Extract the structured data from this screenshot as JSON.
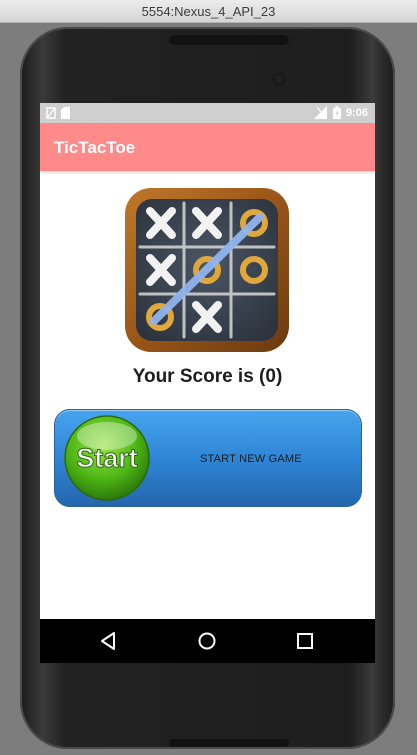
{
  "window": {
    "title": "5554:Nexus_4_API_23"
  },
  "status_bar": {
    "time": "9:06"
  },
  "app_bar": {
    "title": "TicTacToe"
  },
  "main": {
    "score_text": "Your Score is (0)",
    "start_button": {
      "graphic_text": "Start",
      "label": "START NEW GAME"
    }
  },
  "icons": {
    "status_left": [
      "no-sim-icon",
      "sd-card-icon"
    ],
    "status_right": [
      "signal-icon",
      "battery-icon"
    ],
    "nav": [
      "back-icon",
      "home-icon",
      "recents-icon"
    ]
  },
  "colors": {
    "app_bar": "#ff8a8a",
    "status_bar": "#cfcfcf",
    "start_button": "#2f86d6",
    "start_ball": "#4fb816"
  }
}
